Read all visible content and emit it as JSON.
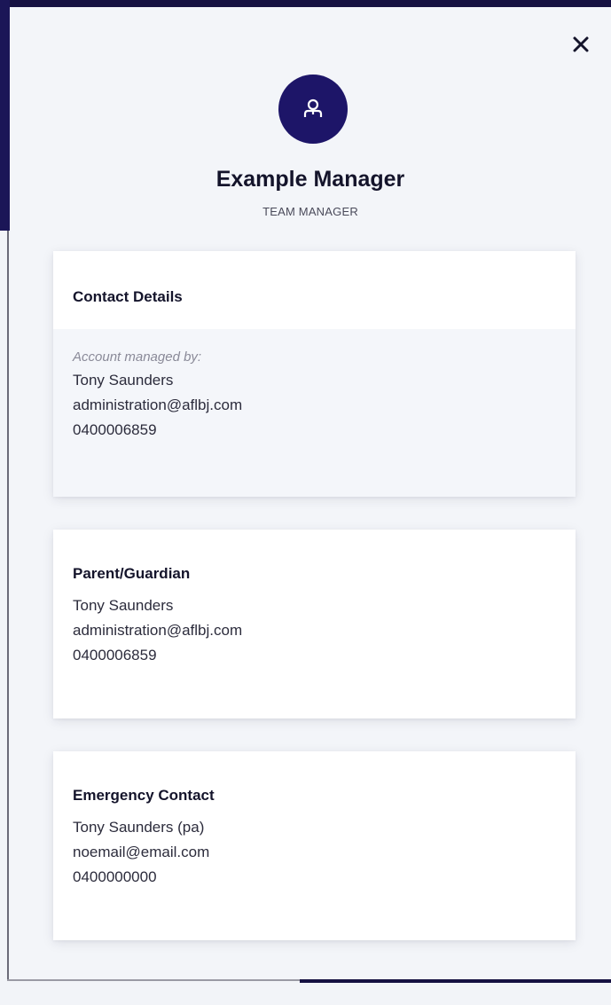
{
  "profile": {
    "name": "Example Manager",
    "role": "TEAM MANAGER"
  },
  "close_label": "Close",
  "contact_details": {
    "title": "Contact Details",
    "managed_by_label": "Account managed by:",
    "name": "Tony Saunders",
    "email": "administration@aflbj.com",
    "phone": "0400006859"
  },
  "parent_guardian": {
    "title": "Parent/Guardian",
    "name": "Tony Saunders",
    "email": "administration@aflbj.com",
    "phone": "0400006859"
  },
  "emergency_contact": {
    "title": "Emergency Contact",
    "name": "Tony Saunders (pa)",
    "email": "noemail@email.com",
    "phone": "0400000000"
  },
  "colors": {
    "avatar_bg": "#1d1568",
    "panel_bg": "#f3f5f9",
    "card_bg": "#ffffff",
    "text": "#14142b"
  },
  "icons": {
    "avatar": "user-icon",
    "close": "close-icon"
  }
}
